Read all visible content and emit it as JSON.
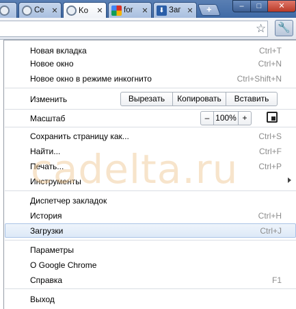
{
  "tabs": [
    {
      "label": "Ce",
      "icon": "globe-icon"
    },
    {
      "label": "Ko",
      "icon": "globe-icon",
      "active": true
    },
    {
      "label": "for",
      "icon": "google-icon"
    },
    {
      "label": "Заг",
      "icon": "download-icon"
    }
  ],
  "new_tab": "+",
  "window": {
    "minimize": "–",
    "maximize": "□",
    "close": "✕"
  },
  "menu": {
    "new_tab": {
      "label": "Новая вкладка",
      "shortcut": "Ctrl+T"
    },
    "new_window": {
      "label": "Новое окно",
      "shortcut": "Ctrl+N"
    },
    "incognito": {
      "label": "Новое окно в режиме инкогнито",
      "shortcut": "Ctrl+Shift+N"
    },
    "edit": {
      "label": "Изменить",
      "cut": "Вырезать",
      "copy": "Копировать",
      "paste": "Вставить"
    },
    "zoom": {
      "label": "Масштаб",
      "minus": "–",
      "value": "100%",
      "plus": "+"
    },
    "save_page": {
      "label": "Сохранить страницу как...",
      "shortcut": "Ctrl+S"
    },
    "find": {
      "label": "Найти...",
      "shortcut": "Ctrl+F"
    },
    "print": {
      "label": "Печать...",
      "shortcut": "Ctrl+P"
    },
    "tools": {
      "label": "Инструменты"
    },
    "bookmark_manager": {
      "label": "Диспетчер закладок"
    },
    "history": {
      "label": "История",
      "shortcut": "Ctrl+H"
    },
    "downloads": {
      "label": "Загрузки",
      "shortcut": "Ctrl+J"
    },
    "settings": {
      "label": "Параметры"
    },
    "about": {
      "label": "О Google Chrome"
    },
    "help": {
      "label": "Справка",
      "shortcut": "F1"
    },
    "exit": {
      "label": "Выход"
    }
  },
  "watermark": "cadelta.ru"
}
